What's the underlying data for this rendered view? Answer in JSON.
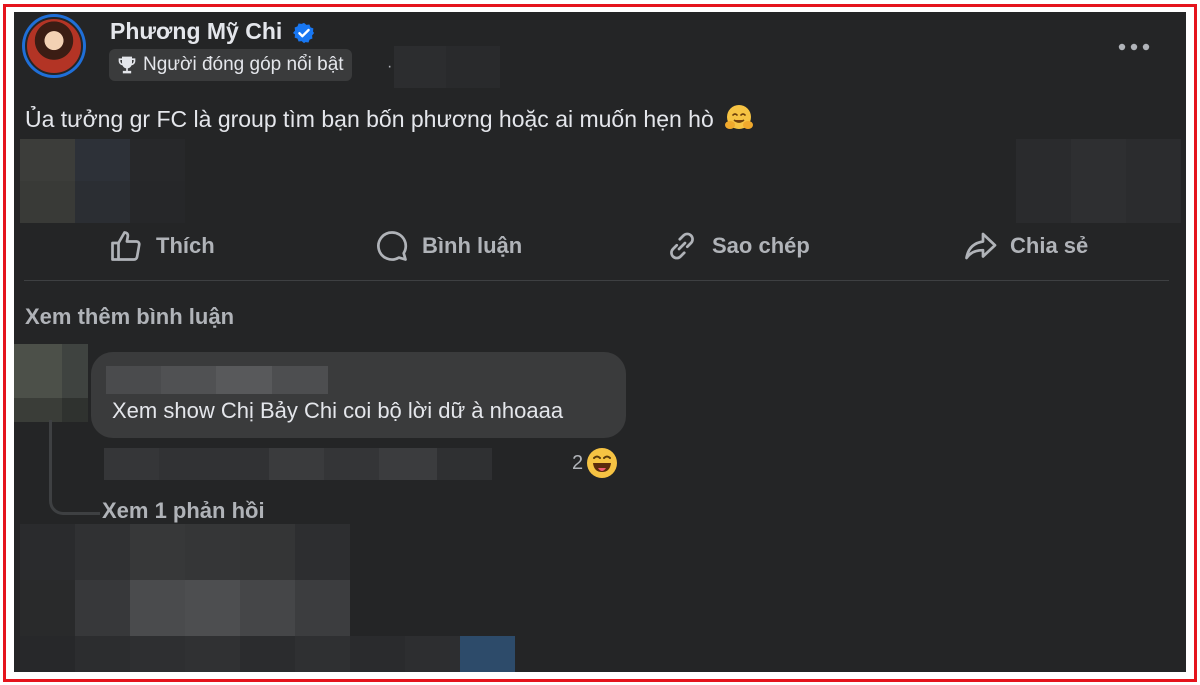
{
  "post": {
    "author_name": "Phương Mỹ Chi",
    "badge_label": "Người đóng góp nổi bật",
    "meta_separator": "·",
    "text": "Ủa tưởng gr FC là group tìm bạn bốn phương hoặc ai muốn hẹn hò",
    "text_emoji": "hugging-face-emoji"
  },
  "actions": {
    "like": "Thích",
    "comment": "Bình luận",
    "copy": "Sao chép",
    "share": "Chia sẻ"
  },
  "comments": {
    "view_more": "Xem thêm bình luận",
    "items": [
      {
        "text": "Xem show Chị Bảy Chi coi bộ lời dữ à nhoaaa",
        "reaction_count": "2",
        "reaction_emoji": "grinning-tongue-emoji",
        "view_replies": "Xem 1 phản hồi"
      }
    ]
  },
  "colors": {
    "frame_border": "#e5141c",
    "post_bg": "#242526",
    "bubble_bg": "#3a3b3c",
    "text_primary": "#e4e6eb",
    "text_secondary": "#b0b3b8",
    "verified_blue": "#1877f2"
  },
  "icons": [
    "verified-icon",
    "trophy-icon",
    "more-icon",
    "like-icon",
    "comment-icon",
    "copy-link-icon",
    "share-icon"
  ]
}
